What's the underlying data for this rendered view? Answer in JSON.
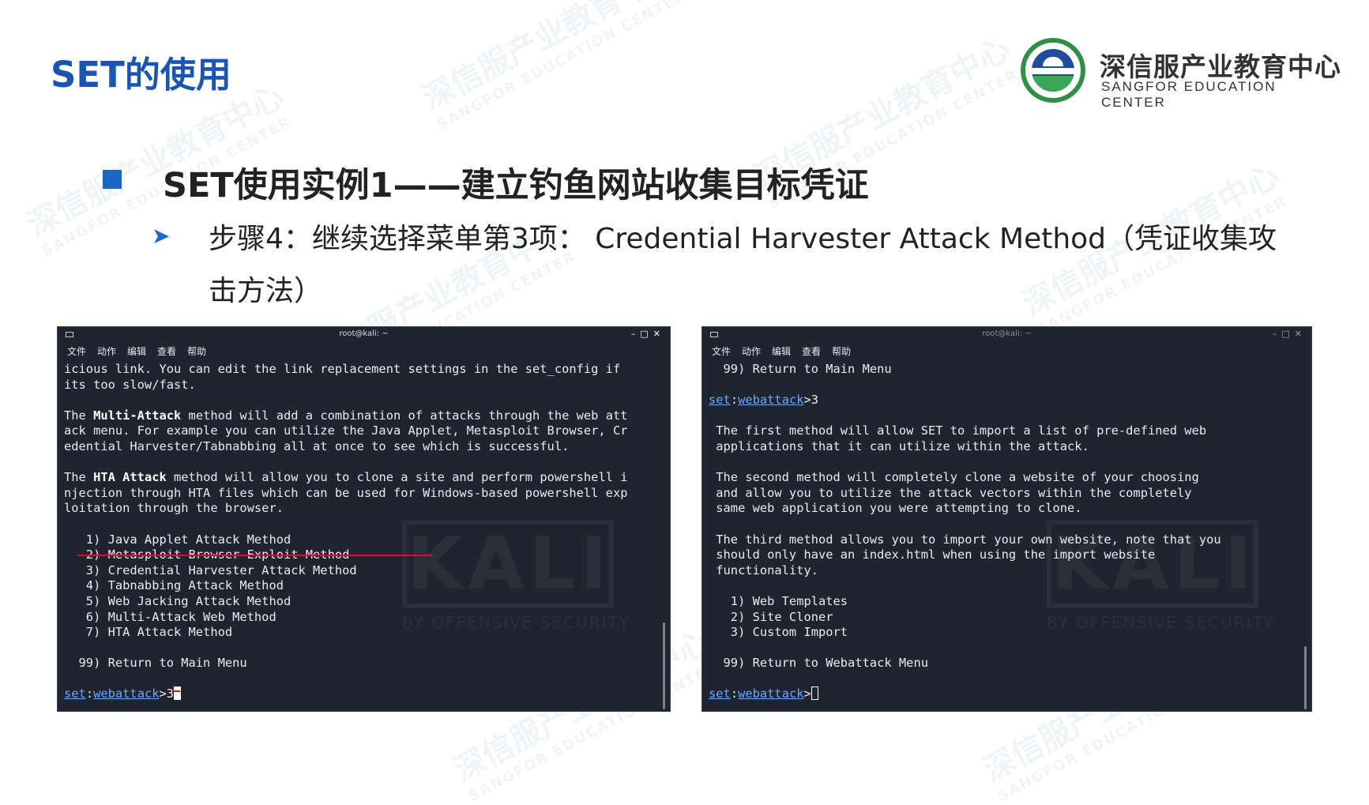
{
  "header": {
    "slide_title": "SET的使用",
    "logo_cn": "深信服产业教育中心",
    "logo_en": "SANGFOR EDUCATION CENTER"
  },
  "section": {
    "heading": "SET使用实例1——建立钓鱼网站收集目标凭证",
    "step_text": "步骤4：继续选择菜单第3项： Credential Harvester Attack Method（凭证收集攻击方法）"
  },
  "watermark": {
    "cn": "深信服产业教育中心",
    "en": "SANGFOR EDUCATION CENTER"
  },
  "terminal_left": {
    "title": "root@kali: ~",
    "menu": [
      "文件",
      "动作",
      "编辑",
      "查看",
      "帮助"
    ],
    "kali_logo": "KALI",
    "kali_sub": "BY OFFENSIVE SECURITY",
    "lines": {
      "l1": "icious link. You can edit the link replacement settings in the set_config if",
      "l2": "its too slow/fast.",
      "l3a": "The ",
      "l3b": "Multi-Attack",
      "l3c": " method will add a combination of attacks through the web att",
      "l4": "ack menu. For example you can utilize the Java Applet, Metasploit Browser, Cr",
      "l5": "edential Harvester/Tabnabbing all at once to see which is successful.",
      "l6a": "The ",
      "l6b": "HTA Attack",
      "l6c": " method will allow you to clone a site and perform powershell i",
      "l7": "njection through HTA files which can be used for Windows-based powershell exp",
      "l8": "loitation through the browser."
    },
    "menu_items": [
      "   1) Java Applet Attack Method",
      "   2) Metasploit Browser Exploit Method",
      "   3) Credential Harvester Attack Method",
      "   4) Tabnabbing Attack Method",
      "   5) Web Jacking Attack Method",
      "   6) Multi-Attack Web Method",
      "   7) HTA Attack Method"
    ],
    "return_item": "  99) Return to Main Menu",
    "prompt_set": "set",
    "prompt_colon": ":",
    "prompt_module": "webattack",
    "prompt_gt": ">",
    "input": "3"
  },
  "terminal_right": {
    "title": "root@kali: ~",
    "menu": [
      "文件",
      "动作",
      "编辑",
      "查看",
      "帮助"
    ],
    "kali_logo": "KALI",
    "kali_sub": "BY OFFENSIVE SECURITY",
    "top_return": "  99) Return to Main Menu",
    "prompt_set": "set",
    "prompt_colon": ":",
    "prompt_module": "webattack",
    "prompt_gt": ">",
    "prompt_input": "3",
    "para1": [
      " The first method will allow SET to import a list of pre-defined web",
      " applications that it can utilize within the attack."
    ],
    "para2": [
      " The second method will completely clone a website of your choosing",
      " and allow you to utilize the attack vectors within the completely",
      " same web application you were attempting to clone."
    ],
    "para3": [
      " The third method allows you to import your own website, note that you",
      " should only have an index.html when using the import website",
      " functionality."
    ],
    "options": [
      "   1) Web Templates",
      "   2) Site Cloner",
      "   3) Custom Import"
    ],
    "return_item": "  99) Return to Webattack Menu"
  },
  "colors": {
    "title_blue": "#1a56b0",
    "bullet_blue": "#1668c4",
    "terminal_bg": "#1f2530",
    "prompt_blue": "#6aa8ff",
    "highlight_red": "#e01010"
  }
}
